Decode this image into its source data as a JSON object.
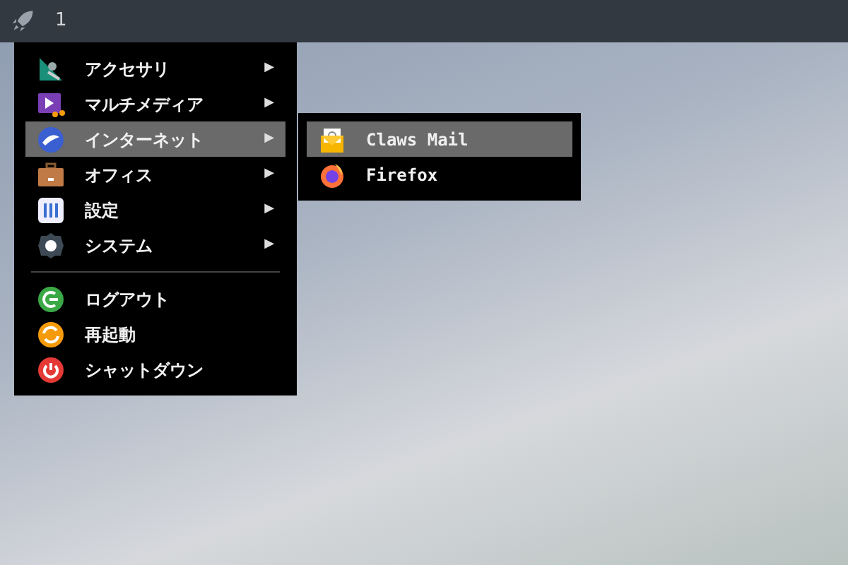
{
  "panel": {
    "workspace": "1"
  },
  "menu": {
    "sections": [
      [
        {
          "label": "アクセサリ",
          "arrow": "▶",
          "selected": false
        },
        {
          "label": "マルチメディア",
          "arrow": "▶",
          "selected": false
        },
        {
          "label": "インターネット",
          "arrow": "▶",
          "selected": true
        },
        {
          "label": "オフィス",
          "arrow": "▶",
          "selected": false
        },
        {
          "label": "設定",
          "arrow": "▶",
          "selected": false
        },
        {
          "label": "システム",
          "arrow": "▶",
          "selected": false
        }
      ],
      [
        {
          "label": "ログアウト",
          "selected": false
        },
        {
          "label": "再起動",
          "selected": false
        },
        {
          "label": "シャットダウン",
          "selected": false
        }
      ]
    ]
  },
  "submenu": {
    "items": [
      {
        "label": "Claws Mail",
        "selected": true
      },
      {
        "label": "Firefox",
        "selected": false
      }
    ]
  }
}
